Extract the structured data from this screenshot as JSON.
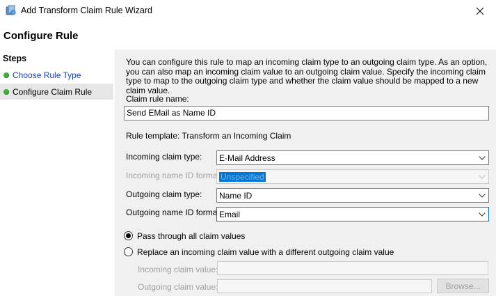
{
  "window": {
    "title": "Add Transform Claim Rule Wizard",
    "icon": "claim-rule-wizard-icon",
    "close_icon": "close-icon"
  },
  "page_title": "Configure Rule",
  "steps": {
    "heading": "Steps",
    "items": [
      {
        "label": "Choose Rule Type",
        "state": "link"
      },
      {
        "label": "Configure Claim Rule",
        "state": "current"
      }
    ],
    "dot_color": "#3fae3a"
  },
  "description": "You can configure this rule to map an incoming claim type to an outgoing claim type. As an option, you can also map an incoming claim value to an outgoing claim value. Specify the incoming claim type to map to the outgoing claim type and whether the claim value should be mapped to a new claim value.",
  "form": {
    "claim_rule_name_label": "Claim rule name:",
    "claim_rule_name_value": "Send EMail as Name ID",
    "rule_template": "Rule template: Transform an Incoming Claim",
    "incoming_claim_type_label": "Incoming claim type:",
    "incoming_claim_type_value": "E-Mail Address",
    "incoming_name_id_format_label": "Incoming name ID format:",
    "incoming_name_id_format_value": "Unspecified",
    "outgoing_claim_type_label": "Outgoing claim type:",
    "outgoing_claim_type_value": "Name ID",
    "outgoing_name_id_format_label": "Outgoing name ID format:",
    "outgoing_name_id_format_value": "Email",
    "radio_pass_through": "Pass through all claim values",
    "radio_replace": "Replace an incoming claim value with a different outgoing claim value",
    "incoming_claim_value_label": "Incoming claim value:",
    "outgoing_claim_value_label": "Outgoing claim value:",
    "browse_label": "Browse..."
  },
  "colors": {
    "accent": "#0078d7",
    "link": "#1a3fbf"
  }
}
